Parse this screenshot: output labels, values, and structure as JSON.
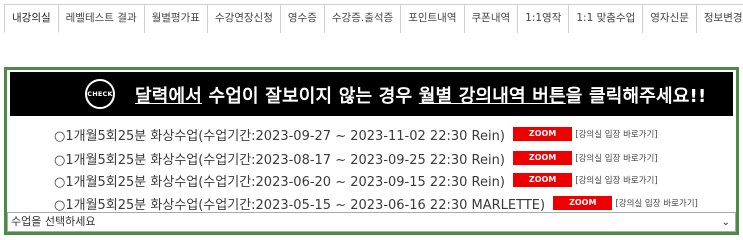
{
  "tabs": [
    {
      "label": "내강의실"
    },
    {
      "label": "레벨테스트 결과"
    },
    {
      "label": "월별평가표"
    },
    {
      "label": "수강연장신청"
    },
    {
      "label": "영수증"
    },
    {
      "label": "수강증.출석증"
    },
    {
      "label": "포인트내역"
    },
    {
      "label": "쿠폰내역"
    },
    {
      "label": "1:1영작"
    },
    {
      "label": "1:1 맞춤수업"
    },
    {
      "label": "영자신문"
    },
    {
      "label": "정보변경"
    }
  ],
  "banner": {
    "badge": "CHECK",
    "text_a": "달력에서",
    "text_b": " 수업이 잘보이지 않는 경우 ",
    "text_c": "월별 강의내역 버튼",
    "text_d": "을 클릭해주세요!!"
  },
  "courses": [
    {
      "title": "○1개월5회25분 화상수업(수업기간:2023-09-27 ~ 2023-11-02 22:30 Rein)",
      "zoom": "ZOOM",
      "link": "[강의실 입장 바로가기]"
    },
    {
      "title": "○1개월5회25분 화상수업(수업기간:2023-08-17 ~ 2023-09-25 22:30 Rein)",
      "zoom": "ZOOM",
      "link": "[강의실 입장 바로가기]"
    },
    {
      "title": "○1개월5회25분 화상수업(수업기간:2023-06-20 ~ 2023-09-15 22:30 Rein)",
      "zoom": "ZOOM",
      "link": "[강의실 입장 바로가기]"
    },
    {
      "title": "○1개월5회25분 화상수업(수업기간:2023-05-15 ~ 2023-06-16 22:30 MARLETTE)",
      "zoom": "ZOOM",
      "link": "[강의실 입장 바로가기]"
    }
  ],
  "select": {
    "selected": "수업을 선택하세요",
    "arrow_icon": "chevron-down-icon"
  },
  "colors": {
    "panel_border": "#4a8c45",
    "banner_bg": "#000000",
    "zoom_bg": "#ee0000"
  }
}
